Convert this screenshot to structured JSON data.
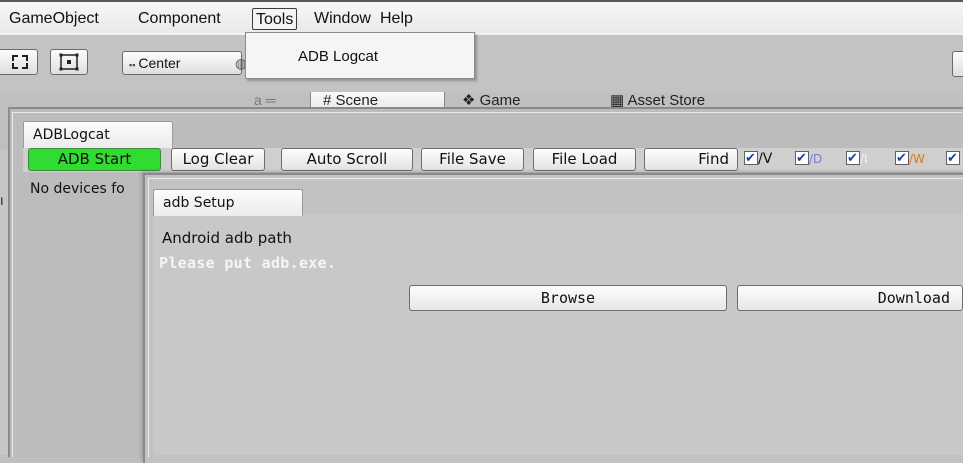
{
  "menubar": {
    "items": [
      "GameObject",
      "Component",
      "Tools",
      "Window",
      "Help"
    ],
    "open_menu": "Tools"
  },
  "tools_menu": {
    "items": [
      "ADB Logcat"
    ]
  },
  "toolbar": {
    "pivot_label": "Center"
  },
  "scene_tabs": [
    "# Scene",
    "Game",
    "Asset Store"
  ],
  "logcat": {
    "tab_title": "ADBLogcat",
    "buttons": [
      "ADB Start",
      "Log Clear",
      "Auto Scroll",
      "File Save",
      "File Load",
      "Find"
    ],
    "filters": [
      {
        "label": "/V",
        "checked": true,
        "color": "#111111"
      },
      {
        "label": "/D",
        "checked": true,
        "color": "#7b7bd6"
      },
      {
        "label": "/I",
        "checked": true,
        "color": "#f5f5f5"
      },
      {
        "label": "/W",
        "checked": true,
        "color": "#e07818"
      },
      {
        "label": "",
        "checked": true,
        "color": "#111111"
      }
    ],
    "status": "No devices fo",
    "start_color": "#2fdc2f"
  },
  "setup": {
    "tab_title": "adb Setup",
    "path_label": "Android adb path",
    "warning": "Please put adb.exe.",
    "browse_label": "Browse",
    "download_label": "Download"
  }
}
